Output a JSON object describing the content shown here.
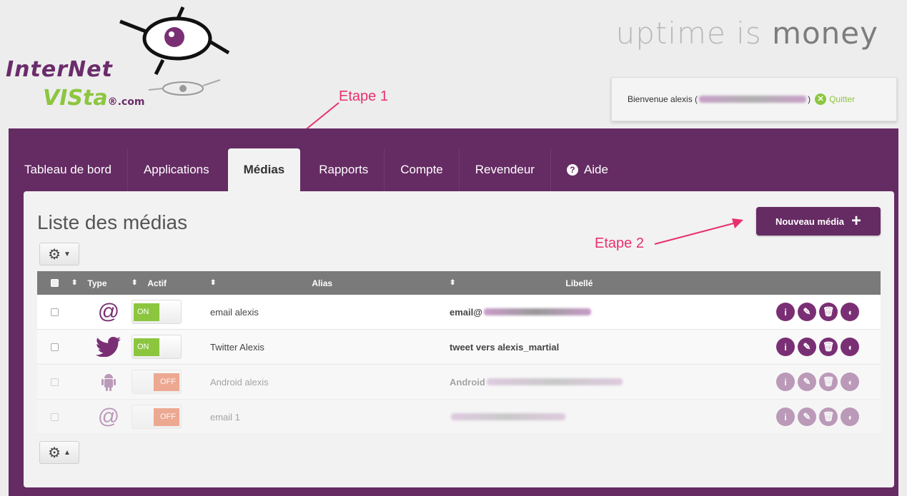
{
  "header": {
    "logo_line1": "InterNet",
    "logo_line2": "VISta",
    "logo_suffix": "®.com",
    "slogan_light": "uptime is ",
    "slogan_bold": "money",
    "welcome_prefix": "Bienvenue alexis (",
    "welcome_suffix": ")",
    "quit_label": "Quitter"
  },
  "annotations": {
    "step1": "Etape 1",
    "step2": "Etape 2"
  },
  "tabs": [
    {
      "label": "Tableau de bord",
      "active": false
    },
    {
      "label": "Applications",
      "active": false
    },
    {
      "label": "Médias",
      "active": true
    },
    {
      "label": "Rapports",
      "active": false
    },
    {
      "label": "Compte",
      "active": false
    },
    {
      "label": "Revendeur",
      "active": false
    },
    {
      "label": "Aide",
      "active": false,
      "icon": "help-icon"
    }
  ],
  "main": {
    "title": "Liste des médias",
    "new_button_label": "Nouveau média",
    "gear_icon": "gear-icon"
  },
  "table": {
    "columns": [
      "Type",
      "Actif",
      "Alias",
      "Libellé"
    ],
    "rows": [
      {
        "type_icon": "at-icon",
        "actif": "ON",
        "alias": "email alexis",
        "libelle": "email@",
        "enabled": true
      },
      {
        "type_icon": "twitter-icon",
        "actif": "ON",
        "alias": "Twitter Alexis",
        "libelle": "tweet vers alexis_martial",
        "enabled": true
      },
      {
        "type_icon": "android-icon",
        "actif": "OFF",
        "alias": "Android alexis",
        "libelle": "Android",
        "enabled": false
      },
      {
        "type_icon": "at-icon",
        "actif": "OFF",
        "alias": "email 1",
        "libelle": "",
        "enabled": false
      }
    ]
  },
  "colors": {
    "brand_purple": "#652b63",
    "accent_green": "#8cc63f",
    "off_orange": "#e85020",
    "annotation_pink": "#e8306e"
  }
}
